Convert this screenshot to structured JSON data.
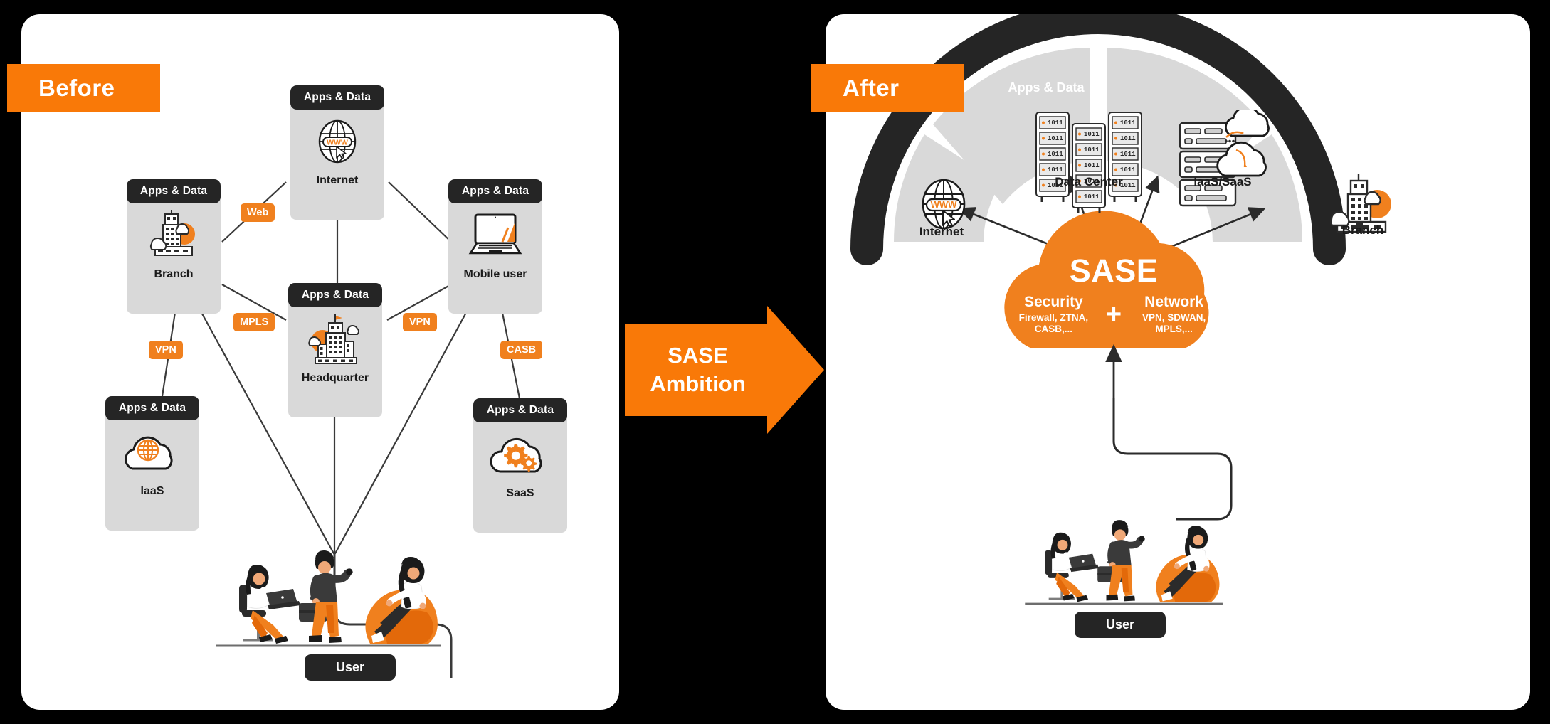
{
  "colors": {
    "background": "#000000",
    "panel": "#ffffff",
    "accent_orange": "#F97908",
    "tag_orange": "#F0801E",
    "dark": "#252525",
    "card_body_gray": "#D9D9D9"
  },
  "before": {
    "badge": "Before",
    "nodes": [
      {
        "header": "Apps & Data",
        "label": "Internet",
        "icon": "globe-www-icon"
      },
      {
        "header": "Apps & Data",
        "label": "Branch",
        "icon": "office-building-icon"
      },
      {
        "header": "Apps & Data",
        "label": "Mobile user",
        "icon": "laptop-icon"
      },
      {
        "header": "Apps & Data",
        "label": "Headquarter",
        "icon": "headquarter-building-icon"
      },
      {
        "header": "Apps & Data",
        "label": "IaaS",
        "icon": "cloud-globe-icon"
      },
      {
        "header": "Apps & Data",
        "label": "SaaS",
        "icon": "cloud-gears-icon"
      }
    ],
    "link_tags": [
      "Web",
      "MPLS",
      "VPN",
      "VPN",
      "CASB"
    ],
    "user_label": "User"
  },
  "center": {
    "arrow_line1": "SASE",
    "arrow_line2": "Ambition"
  },
  "after": {
    "badge": "After",
    "arc_outer_label": "Apps & Data",
    "segments": [
      {
        "label": "Internet",
        "icon": "globe-www-icon"
      },
      {
        "label": "Data Center",
        "icon": "server-rack-icon"
      },
      {
        "label": "IaaS/SaaS",
        "icon": "server-cloud-icon"
      },
      {
        "label": "Branch",
        "icon": "office-building-icon"
      }
    ],
    "cloud": {
      "title": "SASE",
      "plus": "+",
      "left_heading": "Security",
      "left_items": "Firewall, ZTNA, CASB,...",
      "right_heading": "Network",
      "right_items": "VPN, SDWAN, MPLS,..."
    },
    "user_label": "User"
  }
}
